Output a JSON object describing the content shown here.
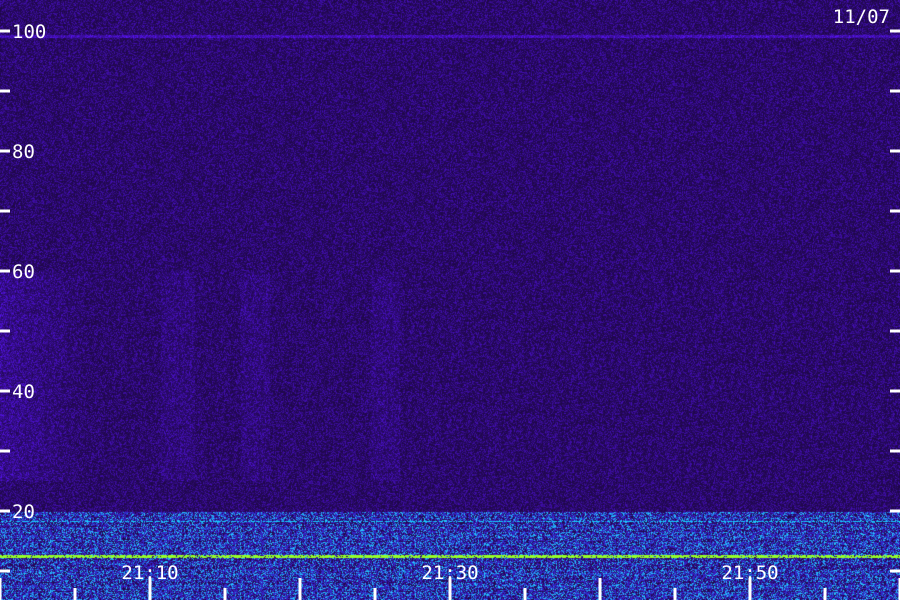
{
  "chart_data": {
    "type": "heatmap",
    "date_label": "11/07",
    "y_ticks": [
      {
        "value": 100,
        "label": "100"
      },
      {
        "value": 90,
        "label": ""
      },
      {
        "value": 80,
        "label": "80"
      },
      {
        "value": 70,
        "label": ""
      },
      {
        "value": 60,
        "label": "60"
      },
      {
        "value": 50,
        "label": ""
      },
      {
        "value": 40,
        "label": "40"
      },
      {
        "value": 30,
        "label": ""
      },
      {
        "value": 20,
        "label": "20"
      },
      {
        "value": 10,
        "label": ""
      }
    ],
    "ylim": [
      0,
      105
    ],
    "x_ticks": [
      {
        "label": "21:10"
      },
      {
        "label": "21:30"
      },
      {
        "label": "21:50"
      }
    ],
    "colors": {
      "background": "#1a0a3a",
      "noise": "#3a10b0",
      "band": "#00d0ff",
      "strong_band": "#a0ff20",
      "axis": "#ffffff"
    }
  }
}
